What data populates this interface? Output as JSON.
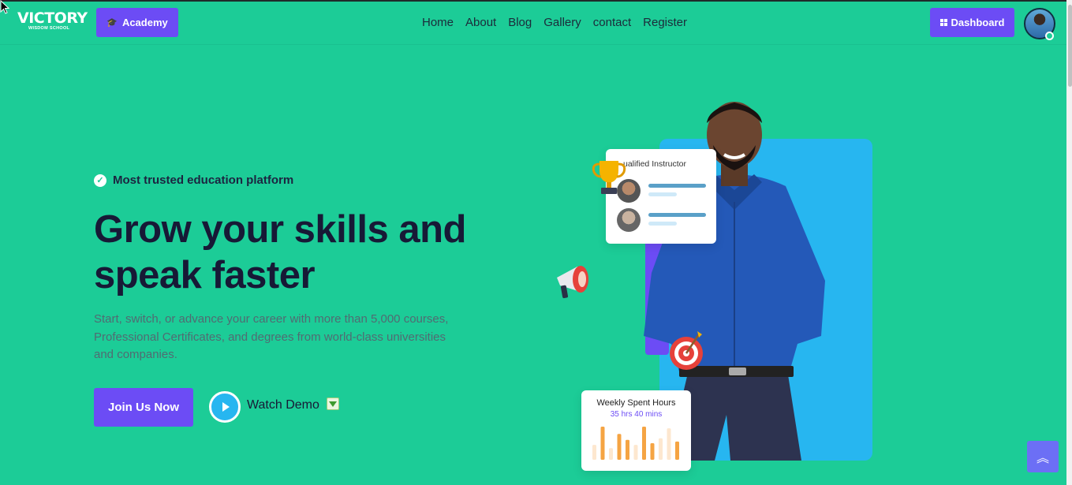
{
  "header": {
    "logo_text": "VICTORY",
    "logo_subtext": "WISDOM SCHOOL",
    "academy_button": "Academy",
    "nav": [
      "Home",
      "About",
      "Blog",
      "Gallery",
      "contact",
      "Register"
    ],
    "dashboard_button": "Dashboard"
  },
  "hero": {
    "badge": "Most trusted education platform",
    "headline_line1": "Grow your skills and",
    "headline_line2": "speak faster",
    "description": "Start, switch, or advance your career with more than 5,000 courses, Professional Certificates, and degrees from world-class universities and companies.",
    "join_button": "Join Us Now",
    "watch_demo": "Watch Demo"
  },
  "illustration": {
    "instructor_card_title": "ualified Instructor",
    "weekly_title": "Weekly Spent Hours",
    "weekly_value": "35 hrs 40 mins",
    "weekly_bars": [
      0.45,
      1.0,
      0.35,
      0.78,
      0.6,
      0.45,
      1.0,
      0.5,
      0.65,
      0.95,
      0.55
    ],
    "weekly_bar_colors": [
      "#fde7cf",
      "#f5a443",
      "#fde7cf",
      "#f5a443",
      "#f5a443",
      "#fde7cf",
      "#f5a443",
      "#f5a443",
      "#fde7cf",
      "#fde7cf",
      "#f5a443"
    ]
  },
  "colors": {
    "background": "#1ccc97",
    "accent": "#6c4cf5",
    "card_blue": "#27b6f0",
    "heading": "#171936"
  },
  "icons": {
    "academy": "graduation-cap-icon",
    "dashboard": "grid-icon",
    "check": "check-circle-icon",
    "play": "play-icon",
    "download": "download-icon",
    "back_to_top": "double-chevron-up-icon"
  }
}
